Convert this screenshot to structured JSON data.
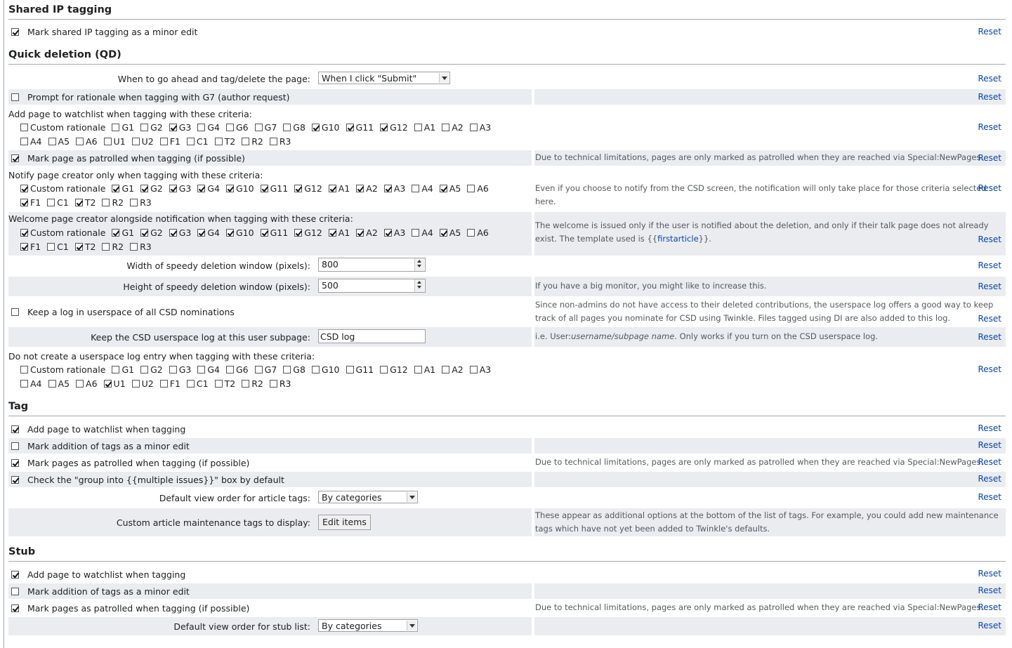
{
  "sections": {
    "shared_ip": "Shared IP tagging",
    "qd": "Quick deletion (QD)",
    "tag": "Tag",
    "stub": "Stub"
  },
  "reset": "Reset",
  "shared_ip": {
    "minor_edit": {
      "label": "Mark shared IP tagging as a minor edit",
      "checked": true
    }
  },
  "qd": {
    "when_label": "When to go ahead and tag/delete the page:",
    "when_value": "When I click \"Submit\"",
    "prompt_g7": {
      "label": "Prompt for rationale when tagging with G7 (author request)",
      "checked": false
    },
    "watch_label": "Add page to watchlist when tagging with these criteria:",
    "watch_criteria": [
      [
        [
          "Custom rationale",
          false
        ],
        [
          "G1",
          false
        ],
        [
          "G2",
          false
        ],
        [
          "G3",
          true
        ],
        [
          "G4",
          false
        ],
        [
          "G6",
          false
        ],
        [
          "G7",
          false
        ],
        [
          "G8",
          false
        ],
        [
          "G10",
          true
        ],
        [
          "G11",
          true
        ],
        [
          "G12",
          true
        ],
        [
          "A1",
          false
        ],
        [
          "A2",
          false
        ],
        [
          "A3",
          false
        ]
      ],
      [
        [
          "A4",
          false
        ],
        [
          "A5",
          false
        ],
        [
          "A6",
          false
        ],
        [
          "U1",
          false
        ],
        [
          "U2",
          false
        ],
        [
          "F1",
          false
        ],
        [
          "C1",
          false
        ],
        [
          "T2",
          false
        ],
        [
          "R2",
          false
        ],
        [
          "R3",
          false
        ]
      ]
    ],
    "patrol": {
      "label": "Mark page as patrolled when tagging (if possible)",
      "checked": true,
      "help": "Due to technical limitations, pages are only marked as patrolled when they are reached via Special:NewPages."
    },
    "notify_label": "Notify page creator only when tagging with these criteria:",
    "notify_criteria": [
      [
        [
          "Custom rationale",
          true
        ],
        [
          "G1",
          true
        ],
        [
          "G2",
          true
        ],
        [
          "G3",
          true
        ],
        [
          "G4",
          true
        ],
        [
          "G10",
          true
        ],
        [
          "G11",
          true
        ],
        [
          "G12",
          true
        ],
        [
          "A1",
          true
        ],
        [
          "A2",
          true
        ],
        [
          "A3",
          true
        ],
        [
          "A4",
          false
        ],
        [
          "A5",
          true
        ],
        [
          "A6",
          false
        ]
      ],
      [
        [
          "F1",
          true
        ],
        [
          "C1",
          false
        ],
        [
          "T2",
          true
        ],
        [
          "R2",
          false
        ],
        [
          "R3",
          false
        ]
      ]
    ],
    "notify_help": "Even if you choose to notify from the CSD screen, the notification will only take place for those criteria selected here.",
    "welcome_label": "Welcome page creator alongside notification when tagging with these criteria:",
    "welcome_criteria": [
      [
        [
          "Custom rationale",
          true
        ],
        [
          "G1",
          true
        ],
        [
          "G2",
          true
        ],
        [
          "G3",
          true
        ],
        [
          "G4",
          true
        ],
        [
          "G10",
          true
        ],
        [
          "G11",
          true
        ],
        [
          "G12",
          true
        ],
        [
          "A1",
          true
        ],
        [
          "A2",
          true
        ],
        [
          "A3",
          true
        ],
        [
          "A4",
          false
        ],
        [
          "A5",
          true
        ],
        [
          "A6",
          false
        ]
      ],
      [
        [
          "F1",
          true
        ],
        [
          "C1",
          false
        ],
        [
          "T2",
          true
        ],
        [
          "R2",
          false
        ],
        [
          "R3",
          false
        ]
      ]
    ],
    "welcome_help_a": "The welcome is issued only if the user is notified about the deletion, and only if their talk page does not already exist. The template used is {{",
    "welcome_help_link": "firstarticle",
    "welcome_help_b": "}}.",
    "width_label": "Width of speedy deletion window (pixels):",
    "width_value": "800",
    "height_label": "Height of speedy deletion window (pixels):",
    "height_value": "500",
    "height_help": "If you have a big monitor, you might like to increase this.",
    "log": {
      "label": "Keep a log in userspace of all CSD nominations",
      "checked": false,
      "help": "Since non-admins do not have access to their deleted contributions, the userspace log offers a good way to keep track of all pages you nominate for CSD using Twinkle. Files tagged using DI are also added to this log."
    },
    "subpage_label": "Keep the CSD userspace log at this user subpage:",
    "subpage_value": "CSD log",
    "subpage_help_a": "i.e. User:",
    "subpage_help_em": "username/subpage name",
    "subpage_help_b": ". Only works if you turn on the CSD userspace log.",
    "nolog_label": "Do not create a userspace log entry when tagging with these criteria:",
    "nolog_criteria": [
      [
        [
          "Custom rationale",
          false
        ],
        [
          "G1",
          false
        ],
        [
          "G2",
          false
        ],
        [
          "G3",
          false
        ],
        [
          "G4",
          false
        ],
        [
          "G6",
          false
        ],
        [
          "G7",
          false
        ],
        [
          "G8",
          false
        ],
        [
          "G10",
          false
        ],
        [
          "G11",
          false
        ],
        [
          "G12",
          false
        ],
        [
          "A1",
          false
        ],
        [
          "A2",
          false
        ],
        [
          "A3",
          false
        ]
      ],
      [
        [
          "A4",
          false
        ],
        [
          "A5",
          false
        ],
        [
          "A6",
          false
        ],
        [
          "U1",
          true
        ],
        [
          "U2",
          false
        ],
        [
          "F1",
          false
        ],
        [
          "C1",
          false
        ],
        [
          "T2",
          false
        ],
        [
          "R2",
          false
        ],
        [
          "R3",
          false
        ]
      ]
    ]
  },
  "tag": {
    "watch": {
      "label": "Add page to watchlist when tagging",
      "checked": true
    },
    "minor": {
      "label": "Mark addition of tags as a minor edit",
      "checked": false
    },
    "patrol": {
      "label": "Mark pages as patrolled when tagging (if possible)",
      "checked": true,
      "help": "Due to technical limitations, pages are only marked as patrolled when they are reached via Special:NewPages."
    },
    "group": {
      "label": "Check the \"group into {{multiple issues}}\" box by default",
      "checked": true
    },
    "order_label": "Default view order for article tags:",
    "order_value": "By categories",
    "custom_label": "Custom article maintenance tags to display:",
    "custom_button": "Edit items",
    "custom_help": "These appear as additional options at the bottom of the list of tags. For example, you could add new maintenance tags which have not yet been added to Twinkle's defaults."
  },
  "stub": {
    "watch": {
      "label": "Add page to watchlist when tagging",
      "checked": true
    },
    "minor": {
      "label": "Mark addition of tags as a minor edit",
      "checked": false
    },
    "patrol": {
      "label": "Mark pages as patrolled when tagging (if possible)",
      "checked": true,
      "help": "Due to technical limitations, pages are only marked as patrolled when they are reached via Special:NewPages."
    },
    "order_label": "Default view order for stub list:",
    "order_value": "By categories"
  }
}
